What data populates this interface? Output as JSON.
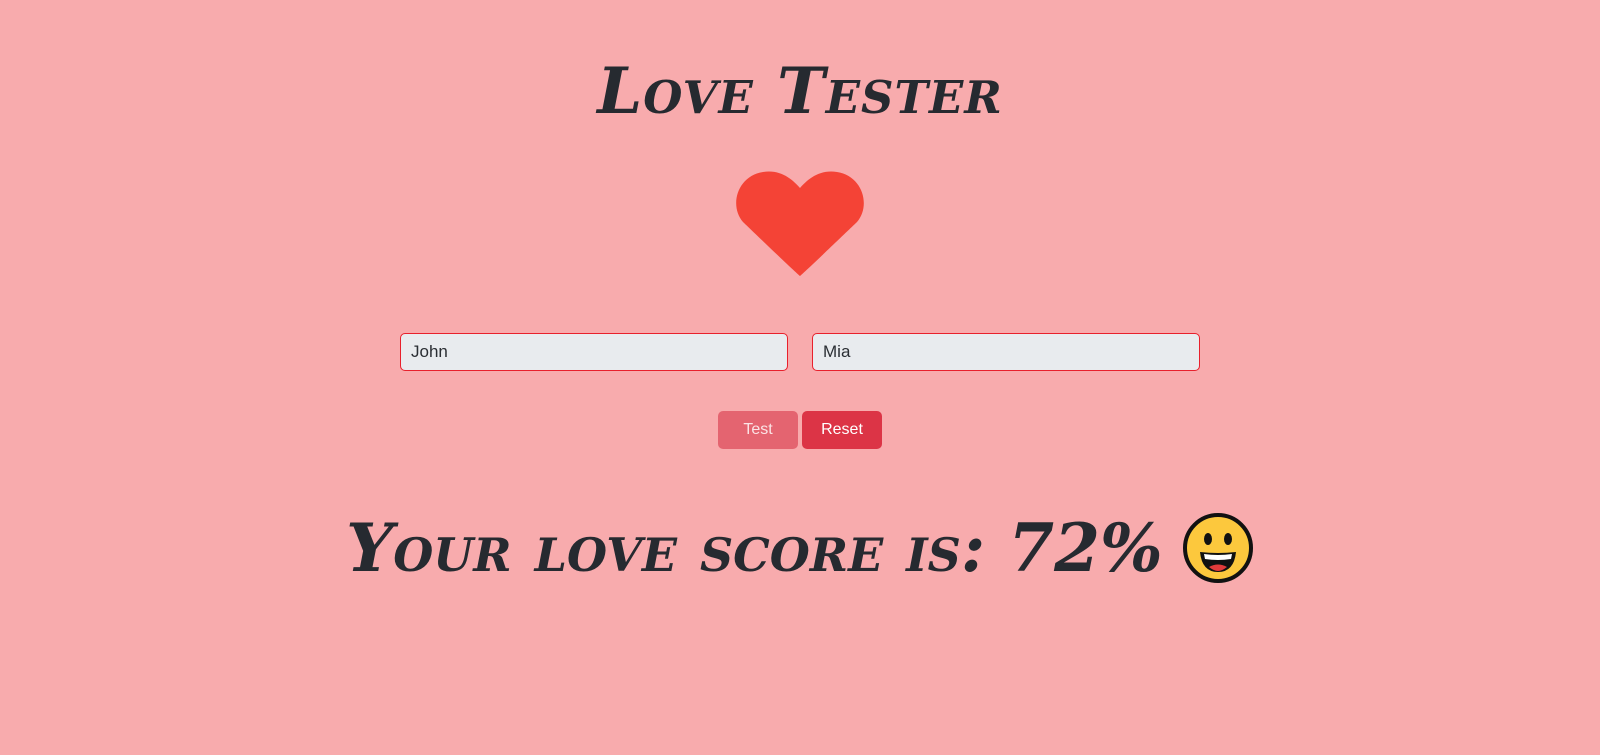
{
  "app": {
    "title": "Love Tester"
  },
  "form": {
    "name1_value": "John",
    "name2_value": "Mia"
  },
  "buttons": {
    "test_label": "Test",
    "reset_label": "Reset"
  },
  "result": {
    "text": "Your love score is: 72%",
    "emoji_icon": "grinning-face-icon"
  },
  "colors": {
    "background": "#f8abad",
    "heart": "#f44336",
    "test_button": "#e46470",
    "reset_button": "#dc3446",
    "input_border": "#e8202c"
  }
}
